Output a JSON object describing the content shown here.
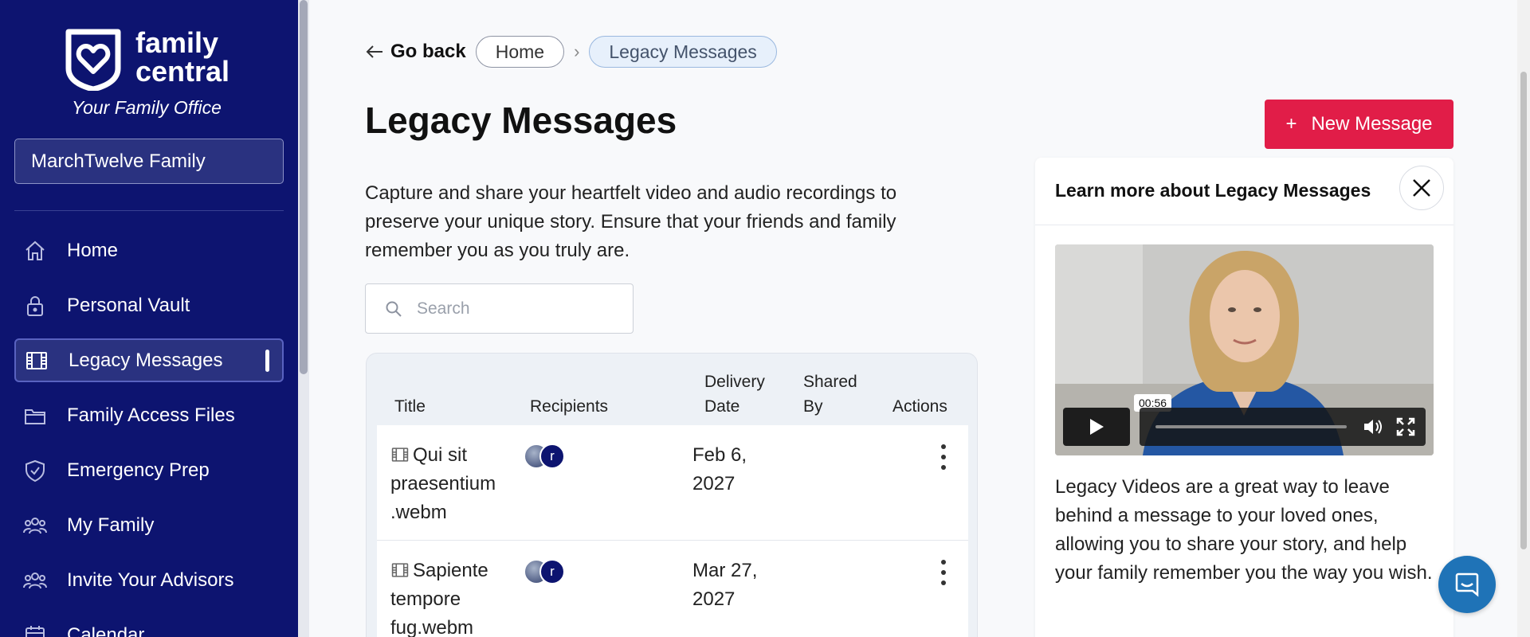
{
  "brand": {
    "name_line1": "family",
    "name_line2": "central",
    "tagline": "Your Family Office",
    "accent": "#e11d48",
    "sidebar_bg": "#0d1470"
  },
  "family_selector": {
    "value": "MarchTwelve Family"
  },
  "sidebar": {
    "items": [
      {
        "label": "Home",
        "icon": "home-icon"
      },
      {
        "label": "Personal Vault",
        "icon": "lock-icon"
      },
      {
        "label": "Legacy Messages",
        "icon": "film-icon",
        "active": true
      },
      {
        "label": "Family Access Files",
        "icon": "folder-icon"
      },
      {
        "label": "Emergency Prep",
        "icon": "shield-icon"
      },
      {
        "label": "My Family",
        "icon": "people-icon"
      },
      {
        "label": "Invite Your Advisors",
        "icon": "people-icon"
      },
      {
        "label": "Calendar",
        "icon": "calendar-icon"
      }
    ]
  },
  "breadcrumb": {
    "back_label": "Go back",
    "items": [
      "Home",
      "Legacy Messages"
    ]
  },
  "page": {
    "title": "Legacy Messages",
    "new_button_label": "New Message",
    "description": "Capture and share your heartfelt video and audio recordings to preserve your unique story. Ensure that your friends and family remember you as you truly are."
  },
  "search": {
    "placeholder": "Search",
    "value": ""
  },
  "table": {
    "headers": {
      "title": "Title",
      "recipients": "Recipients",
      "delivery_date_1": "Delivery",
      "delivery_date_2": "Date",
      "shared_by_1": "Shared",
      "shared_by_2": "By",
      "actions": "Actions"
    },
    "rows": [
      {
        "title": "Qui sit praesentium .webm",
        "recipient_initial": "r",
        "delivery_date": "Feb 6, 2027",
        "shared_by": ""
      },
      {
        "title": "Sapiente tempore fug.webm",
        "recipient_initial": "r",
        "delivery_date": "Mar 27, 2027",
        "shared_by": ""
      }
    ]
  },
  "info_panel": {
    "title": "Learn more about Legacy Messages",
    "video_timecode": "00:56",
    "text": "Legacy Videos are a great way to leave behind a message to your loved ones, allowing you to share your story, and help your family remember you the way you wish."
  }
}
